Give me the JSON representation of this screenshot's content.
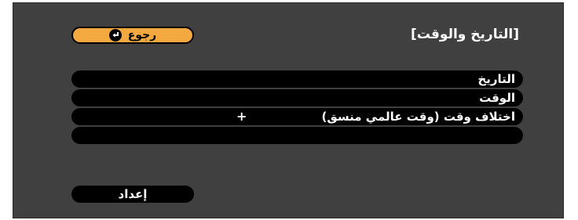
{
  "title": "[التاريخ والوقت]",
  "back_button": {
    "label": "رجوع",
    "icon": "return-arrow-icon"
  },
  "items": [
    {
      "label": "التاريخ",
      "value": ""
    },
    {
      "label": "الوقت",
      "value": ""
    },
    {
      "label": "اختلاف وقت (وقت عالمي منسق)",
      "value": "+"
    },
    {
      "label": "",
      "value": ""
    }
  ],
  "setup_button": {
    "label": "إعداد"
  },
  "colors": {
    "panel": "#404040",
    "highlight": "#f4a940",
    "row": "#000000",
    "text": "#ffffff"
  }
}
